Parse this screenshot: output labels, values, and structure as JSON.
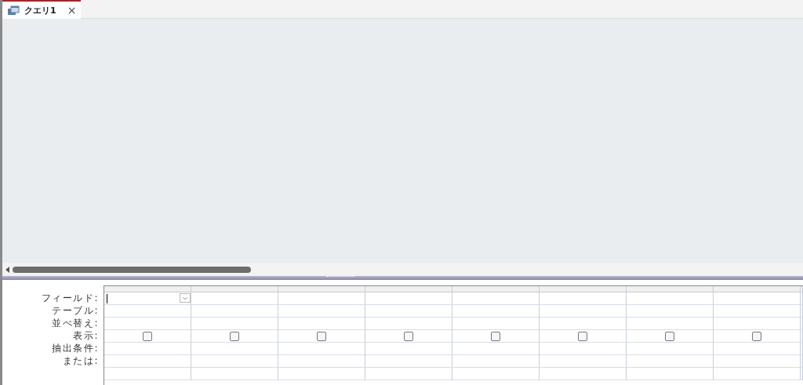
{
  "tabs": [
    {
      "label": "クエリ1",
      "close": "×",
      "selected": true
    }
  ],
  "design_grid": {
    "row_labels": [
      "フィールド:",
      "テーブル:",
      "並べ替え:",
      "表示:",
      "抽出条件:",
      "または:"
    ],
    "columns": [
      {
        "kind": "dropdown",
        "show": false
      },
      {
        "kind": "plain",
        "show": false
      },
      {
        "kind": "plain",
        "show": false
      },
      {
        "kind": "plain",
        "show": false
      },
      {
        "kind": "plain",
        "show": false
      },
      {
        "kind": "plain",
        "show": false
      },
      {
        "kind": "plain",
        "show": false
      },
      {
        "kind": "plain",
        "show": false
      }
    ]
  }
}
